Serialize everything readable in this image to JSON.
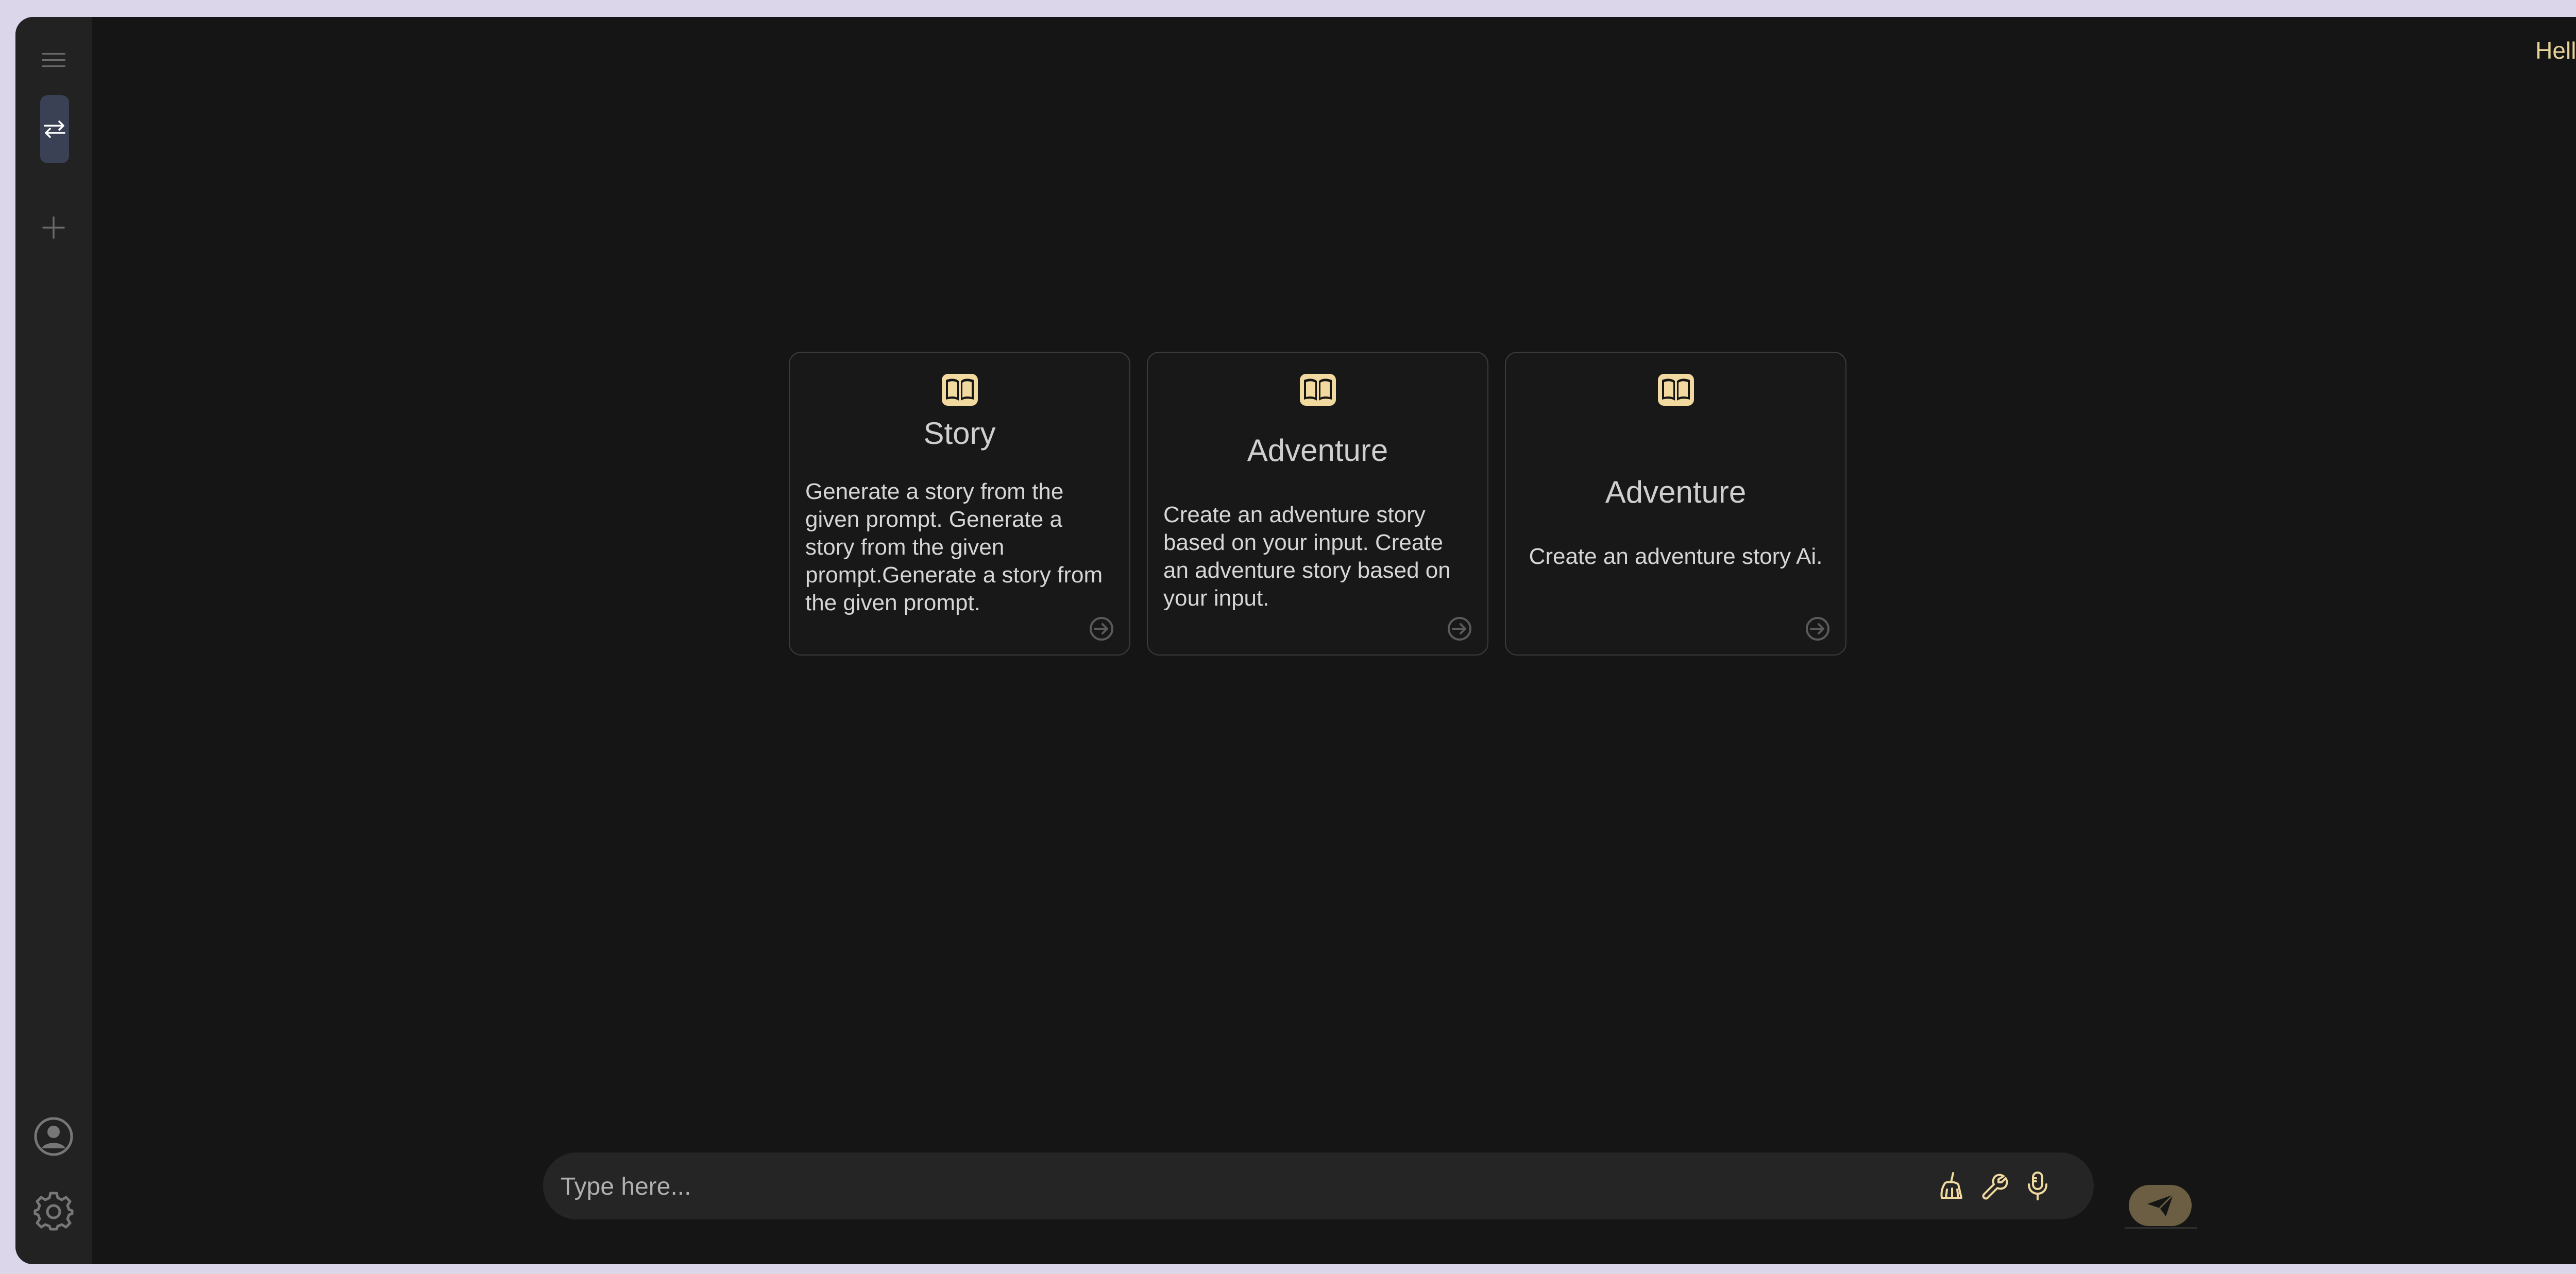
{
  "header": {
    "greeting": "Hello"
  },
  "sidebar": {
    "items": [
      {
        "icon": "hamburger-menu-icon"
      },
      {
        "icon": "swap-arrows-icon",
        "active": true
      },
      {
        "icon": "plus-icon"
      },
      {
        "icon": "user-circle-icon"
      },
      {
        "icon": "gear-icon"
      }
    ]
  },
  "cards": [
    {
      "icon": "open-book-icon",
      "title": "Story",
      "description": "Generate a story from the given prompt. Generate a story from the given prompt.Generate a story from the given prompt."
    },
    {
      "icon": "open-book-icon",
      "title": "Adventure",
      "description": "Create an adventure story based on your input. Create an adventure story based on your input."
    },
    {
      "icon": "open-book-icon",
      "title": "Adventure",
      "description": "Create an adventure story Ai."
    }
  ],
  "composer": {
    "placeholder": "Type here...",
    "value": "",
    "tools": [
      "broom-icon",
      "wrench-icon",
      "microphone-icon"
    ],
    "send_icon": "paper-plane-icon"
  },
  "colors": {
    "background": "#151515",
    "sidebar": "#222223",
    "accent": "#e7d29a",
    "send_button": "#6b5e42",
    "active_sidebar_item": "#3a4154"
  }
}
